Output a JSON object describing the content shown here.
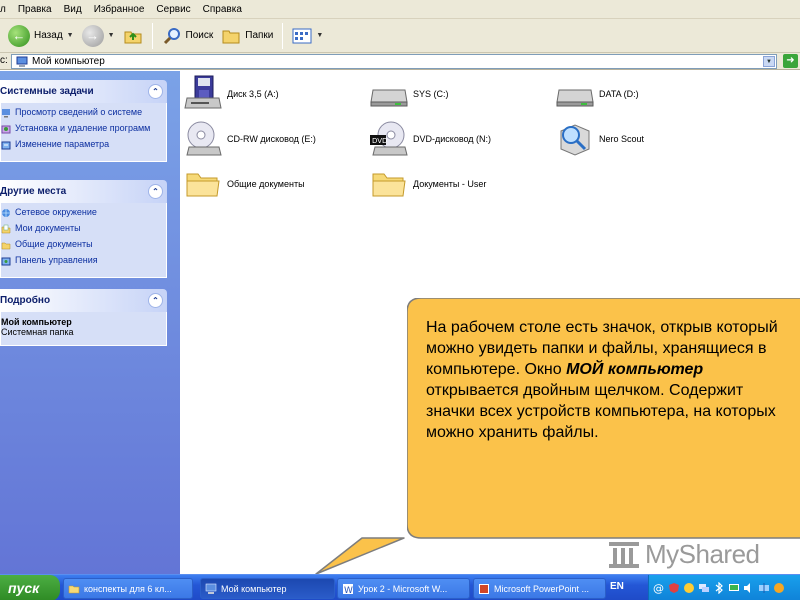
{
  "menubar": {
    "items": [
      "л",
      "Правка",
      "Вид",
      "Избранное",
      "Сервис",
      "Справка"
    ]
  },
  "toolbar": {
    "back_label": "Назад",
    "search_label": "Поиск",
    "folders_label": "Папки"
  },
  "address": {
    "label": "с:",
    "value": "Мой компьютер"
  },
  "left_panel": {
    "system_tasks": {
      "title": "Системные задачи",
      "items": [
        "Просмотр сведений о системе",
        "Установка и удаление программ",
        "Изменение параметра"
      ]
    },
    "other_places": {
      "title": "Другие места",
      "items": [
        "Сетевое окружение",
        "Мои документы",
        "Общие документы",
        "Панель управления"
      ]
    },
    "details": {
      "title": "Подробно",
      "name": "Мой компьютер",
      "type": "Системная папка"
    }
  },
  "drives": [
    {
      "label": "Диск 3,5 (A:)",
      "icon": "floppy-drive-icon"
    },
    {
      "label": "SYS (C:)",
      "icon": "hard-drive-icon"
    },
    {
      "label": "DATA (D:)",
      "icon": "hard-drive-icon"
    },
    {
      "label": "CD-RW дисковод (E:)",
      "icon": "cd-drive-icon"
    },
    {
      "label": "DVD-дисковод (N:)",
      "icon": "dvd-drive-icon"
    },
    {
      "label": "Nero Scout",
      "icon": "nero-scout-icon"
    },
    {
      "label": "Общие документы",
      "icon": "folder-icon"
    },
    {
      "label": "Документы - User",
      "icon": "folder-icon"
    }
  ],
  "callout": {
    "text_before": "На рабочем столе есть значок, открыв который можно увидеть папки и файлы, хранящиеся в компьютере. Окно ",
    "emphasis": "МОЙ компьютер",
    "text_after": " открывается двойным щелчком. Содержит значки всех устройств компьютера, на которых можно хранить файлы."
  },
  "watermark": {
    "text": "MyShared"
  },
  "taskbar": {
    "start_label": "пуск",
    "tasks": [
      "конспекты для 6 кл...",
      "Мой компьютер",
      "Урок 2 - Microsoft W...",
      "Microsoft PowerPoint ..."
    ],
    "language": "EN"
  },
  "colors": {
    "window_bg": "#ece9d8",
    "panel_gradient_top": "#7ba2e7",
    "panel_gradient_bottom": "#6375d6",
    "callout_fill": "#fbc24a",
    "taskbar": "#245edb",
    "start_button": "#3c9d32"
  }
}
